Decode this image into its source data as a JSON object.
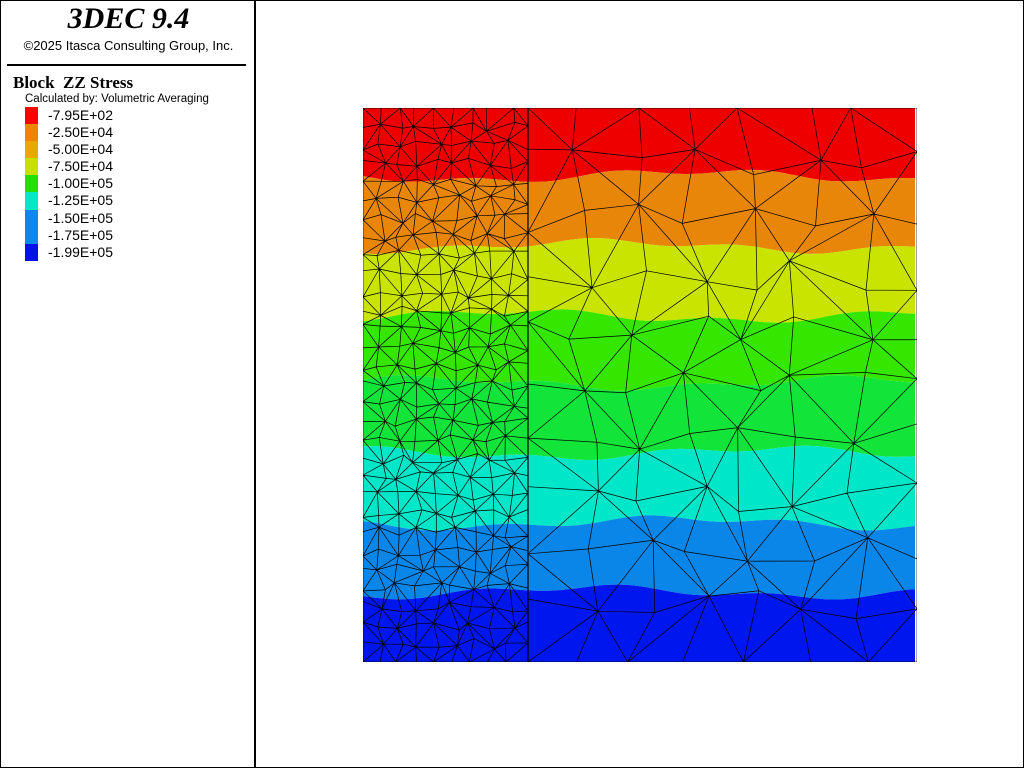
{
  "app": {
    "title": "3DEC 9.4",
    "copyright": "©2025 Itasca Consulting Group, Inc."
  },
  "plot": {
    "title": "Block  ZZ Stress",
    "subtitle": "Calculated by: Volumetric Averaging"
  },
  "legend": {
    "items": [
      {
        "label": "-7.95E+02",
        "color": "#ff0000"
      },
      {
        "label": "-2.50E+04",
        "color": "#ee8400"
      },
      {
        "label": "-5.00E+04",
        "color": "#e8a800"
      },
      {
        "label": "-7.50E+04",
        "color": "#c8e000"
      },
      {
        "label": "-1.00E+05",
        "color": "#22e000"
      },
      {
        "label": "-1.25E+05",
        "color": "#00e8c8"
      },
      {
        "label": "-1.50E+05",
        "color": "#0a88ee"
      },
      {
        "label": "-1.75E+05",
        "color": "#0a88ee"
      },
      {
        "label": "-1.99E+05",
        "color": "#0010ee"
      }
    ]
  },
  "contour": {
    "bands": [
      {
        "color": "#ee0000"
      },
      {
        "color": "#e8860a"
      },
      {
        "color": "#c8e400"
      },
      {
        "color": "#34e600"
      },
      {
        "color": "#12e43a"
      },
      {
        "color": "#00e6c8"
      },
      {
        "color": "#0a86e8"
      },
      {
        "color": "#0016ee"
      }
    ]
  }
}
